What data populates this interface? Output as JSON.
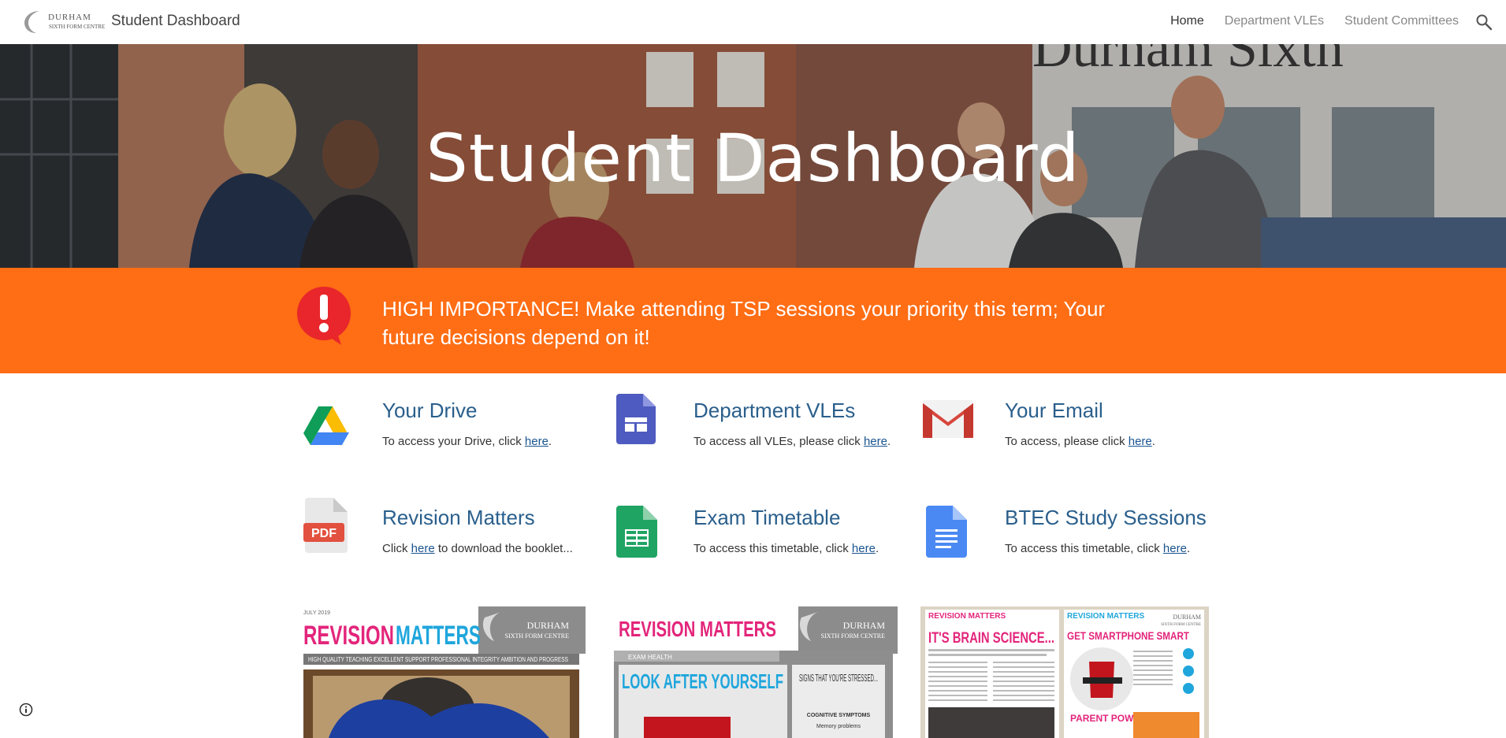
{
  "header": {
    "logo_line1": "DURHAM",
    "logo_line2": "SIXTH FORM CENTRE",
    "site_title": "Student Dashboard",
    "nav": [
      {
        "label": "Home",
        "active": true
      },
      {
        "label": "Department VLEs",
        "active": false
      },
      {
        "label": "Student Committees",
        "active": false
      }
    ],
    "search_icon": "search-icon"
  },
  "hero": {
    "title": "Student Dashboard",
    "signage_text": "Durham Sixth"
  },
  "alert": {
    "icon": "exclamation-icon",
    "text": "HIGH IMPORTANCE! Make attending TSP sessions your priority this term; Your future decisions depend on it!"
  },
  "cards": [
    {
      "title": "Your Drive",
      "pre": "To access your Drive, click ",
      "link": "here",
      "post": ".",
      "icon": "google-drive-icon"
    },
    {
      "title": "Department VLEs",
      "pre": "To access all VLEs, please click ",
      "link": "here",
      "post": ".",
      "icon": "google-sites-icon"
    },
    {
      "title": "Your Email",
      "pre": "To access, please click ",
      "link": "here",
      "post": ".",
      "icon": "gmail-icon"
    },
    {
      "title": "Revision Matters",
      "pre": "Click ",
      "link": "here",
      "post": " to download the booklet...",
      "icon": "pdf-icon"
    },
    {
      "title": "Exam Timetable",
      "pre": "To access this timetable, click ",
      "link": "here",
      "post": ".",
      "icon": "google-sheets-icon"
    },
    {
      "title": "BTEC Study Sessions",
      "pre": "To access this timetable, click ",
      "link": "here",
      "post": ".",
      "icon": "google-docs-icon"
    }
  ],
  "booklets": [
    {
      "date": "JULY 2019",
      "brand1": "REVISION",
      "brand2": "MATTERS",
      "org1": "DURHAM",
      "org2": "SIXTH FORM CENTRE",
      "strap": "HIGH QUALITY TEACHING   EXCELLENT SUPPORT   PROFESSIONAL INTEGRITY   AMBITION AND PROGRESS"
    },
    {
      "brand": "REVISION MATTERS",
      "org1": "DURHAM",
      "org2": "SIXTH FORM CENTRE",
      "tab": "EXAM HEALTH",
      "headline": "LOOK AFTER YOURSELF",
      "signs": "SIGNS THAT YOU'RE STRESSED...",
      "sub": "COGNITIVE SYMPTOMS",
      "sub2": "Memory problems"
    },
    {
      "left_brand": "REVISION MATTERS",
      "right_brand": "REVISION MATTERS",
      "org1": "DURHAM",
      "org2": "SIXTH FORM CENTRE",
      "left_headline": "IT'S BRAIN SCIENCE...",
      "right_headline": "GET SMARTPHONE SMART",
      "right_sub": "PARENT POWER!"
    }
  ],
  "footer": {
    "info_icon": "info-icon"
  },
  "colors": {
    "alert_bg": "#ff6d14",
    "title_blue": "#2a5f8c",
    "link_blue": "#1a5490",
    "magenta": "#e3257b",
    "cyan": "#1fa6dc"
  }
}
